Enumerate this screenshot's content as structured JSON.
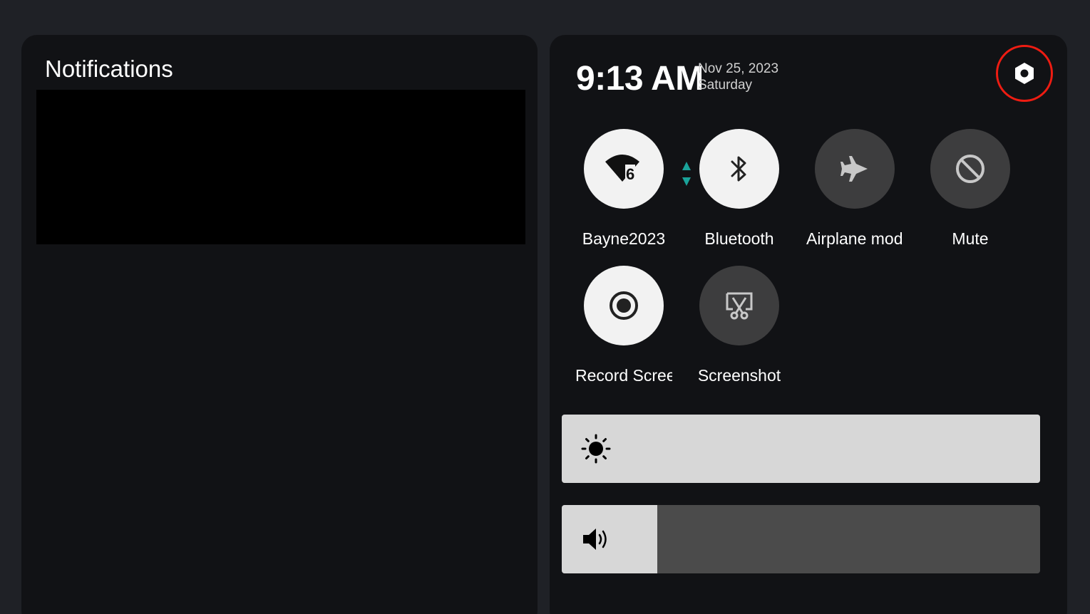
{
  "notifications": {
    "title": "Notifications"
  },
  "quick_settings": {
    "time": "9:13 AM",
    "date": "Nov 25, 2023",
    "weekday": "Saturday",
    "settings_icon": "settings-gear-icon",
    "tiles": [
      {
        "label": "Bayne2023",
        "icon": "wifi-6-icon",
        "active": true
      },
      {
        "label": "Bluetooth",
        "icon": "bluetooth-icon",
        "active": true
      },
      {
        "label": "Airplane mode",
        "icon": "airplane-icon",
        "active": false
      },
      {
        "label": "Mute",
        "icon": "mute-icon",
        "active": false
      },
      {
        "label": "Record Screen",
        "icon": "record-icon",
        "active": true
      },
      {
        "label": "Screenshot",
        "icon": "screenshot-icon",
        "active": false
      }
    ],
    "brightness": {
      "icon": "brightness-icon",
      "level": 1.0
    },
    "volume": {
      "icon": "volume-icon",
      "level": 0.2
    }
  },
  "colors": {
    "accent_highlight": "#ee1c12",
    "wifi_activity": "#1aa39a",
    "tile_on": "#f2f2f2",
    "tile_off": "#3d3d3e"
  }
}
